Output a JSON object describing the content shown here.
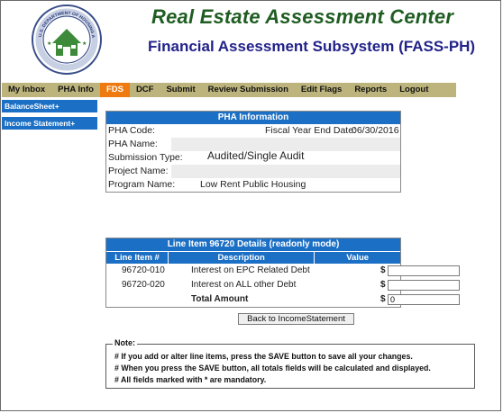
{
  "header": {
    "title": "Real Estate Assessment Center",
    "subtitle": "Financial Assessment Subsystem (FASS-PH)",
    "seal_ring_text": "U.S. DEPARTMENT OF HOUSING AND URBAN DEVELOPMENT"
  },
  "nav": {
    "items": [
      {
        "label": "My Inbox"
      },
      {
        "label": "PHA Info"
      },
      {
        "label": "FDS",
        "active": true
      },
      {
        "label": "DCF"
      },
      {
        "label": "Submit"
      },
      {
        "label": "Review Submission"
      },
      {
        "label": "Edit Flags"
      },
      {
        "label": "Reports"
      },
      {
        "label": "Logout"
      }
    ]
  },
  "sidebar": {
    "items": [
      {
        "label": "BalanceSheet+"
      },
      {
        "label": "Income Statement+"
      }
    ]
  },
  "pha_info": {
    "header": "PHA Information",
    "code_label": "PHA Code:",
    "code_value": "",
    "fye_label": "Fiscal Year End Date:",
    "fye_value": "06/30/2016",
    "name_label": "PHA Name:",
    "name_value": "",
    "submission_type_label": "Submission Type:",
    "submission_type_value": "Audited/Single Audit",
    "project_name_label": "Project Name:",
    "project_name_value": "",
    "program_name_label": "Program Name:",
    "program_name_value": "Low Rent Public Housing"
  },
  "line_item": {
    "header": "Line Item 96720 Details (readonly mode)",
    "columns": [
      "Line Item #",
      "Description",
      "Value"
    ],
    "rows": [
      {
        "number": "96720-010",
        "description": "Interest on EPC Related Debt",
        "currency": "$",
        "value": ""
      },
      {
        "number": "96720-020",
        "description": "Interest on ALL other Debt",
        "currency": "$",
        "value": ""
      }
    ],
    "total_label": "Total Amount",
    "total_currency": "$",
    "total_value": "0",
    "back_button": "Back to IncomeStatement"
  },
  "note": {
    "title": "Note:",
    "lines": [
      "# If you add or alter line items, press the SAVE button to save all your changes.",
      "# When you press the SAVE button, all totals fields will be calculated and displayed.",
      "# All fields marked with * are mandatory."
    ]
  },
  "colors": {
    "title_green": "#1f5d22",
    "subtitle_navy": "#22228a",
    "nav_bg": "#bcb47c",
    "nav_active": "#ee7a10",
    "table_blue": "#1b6fc4"
  }
}
